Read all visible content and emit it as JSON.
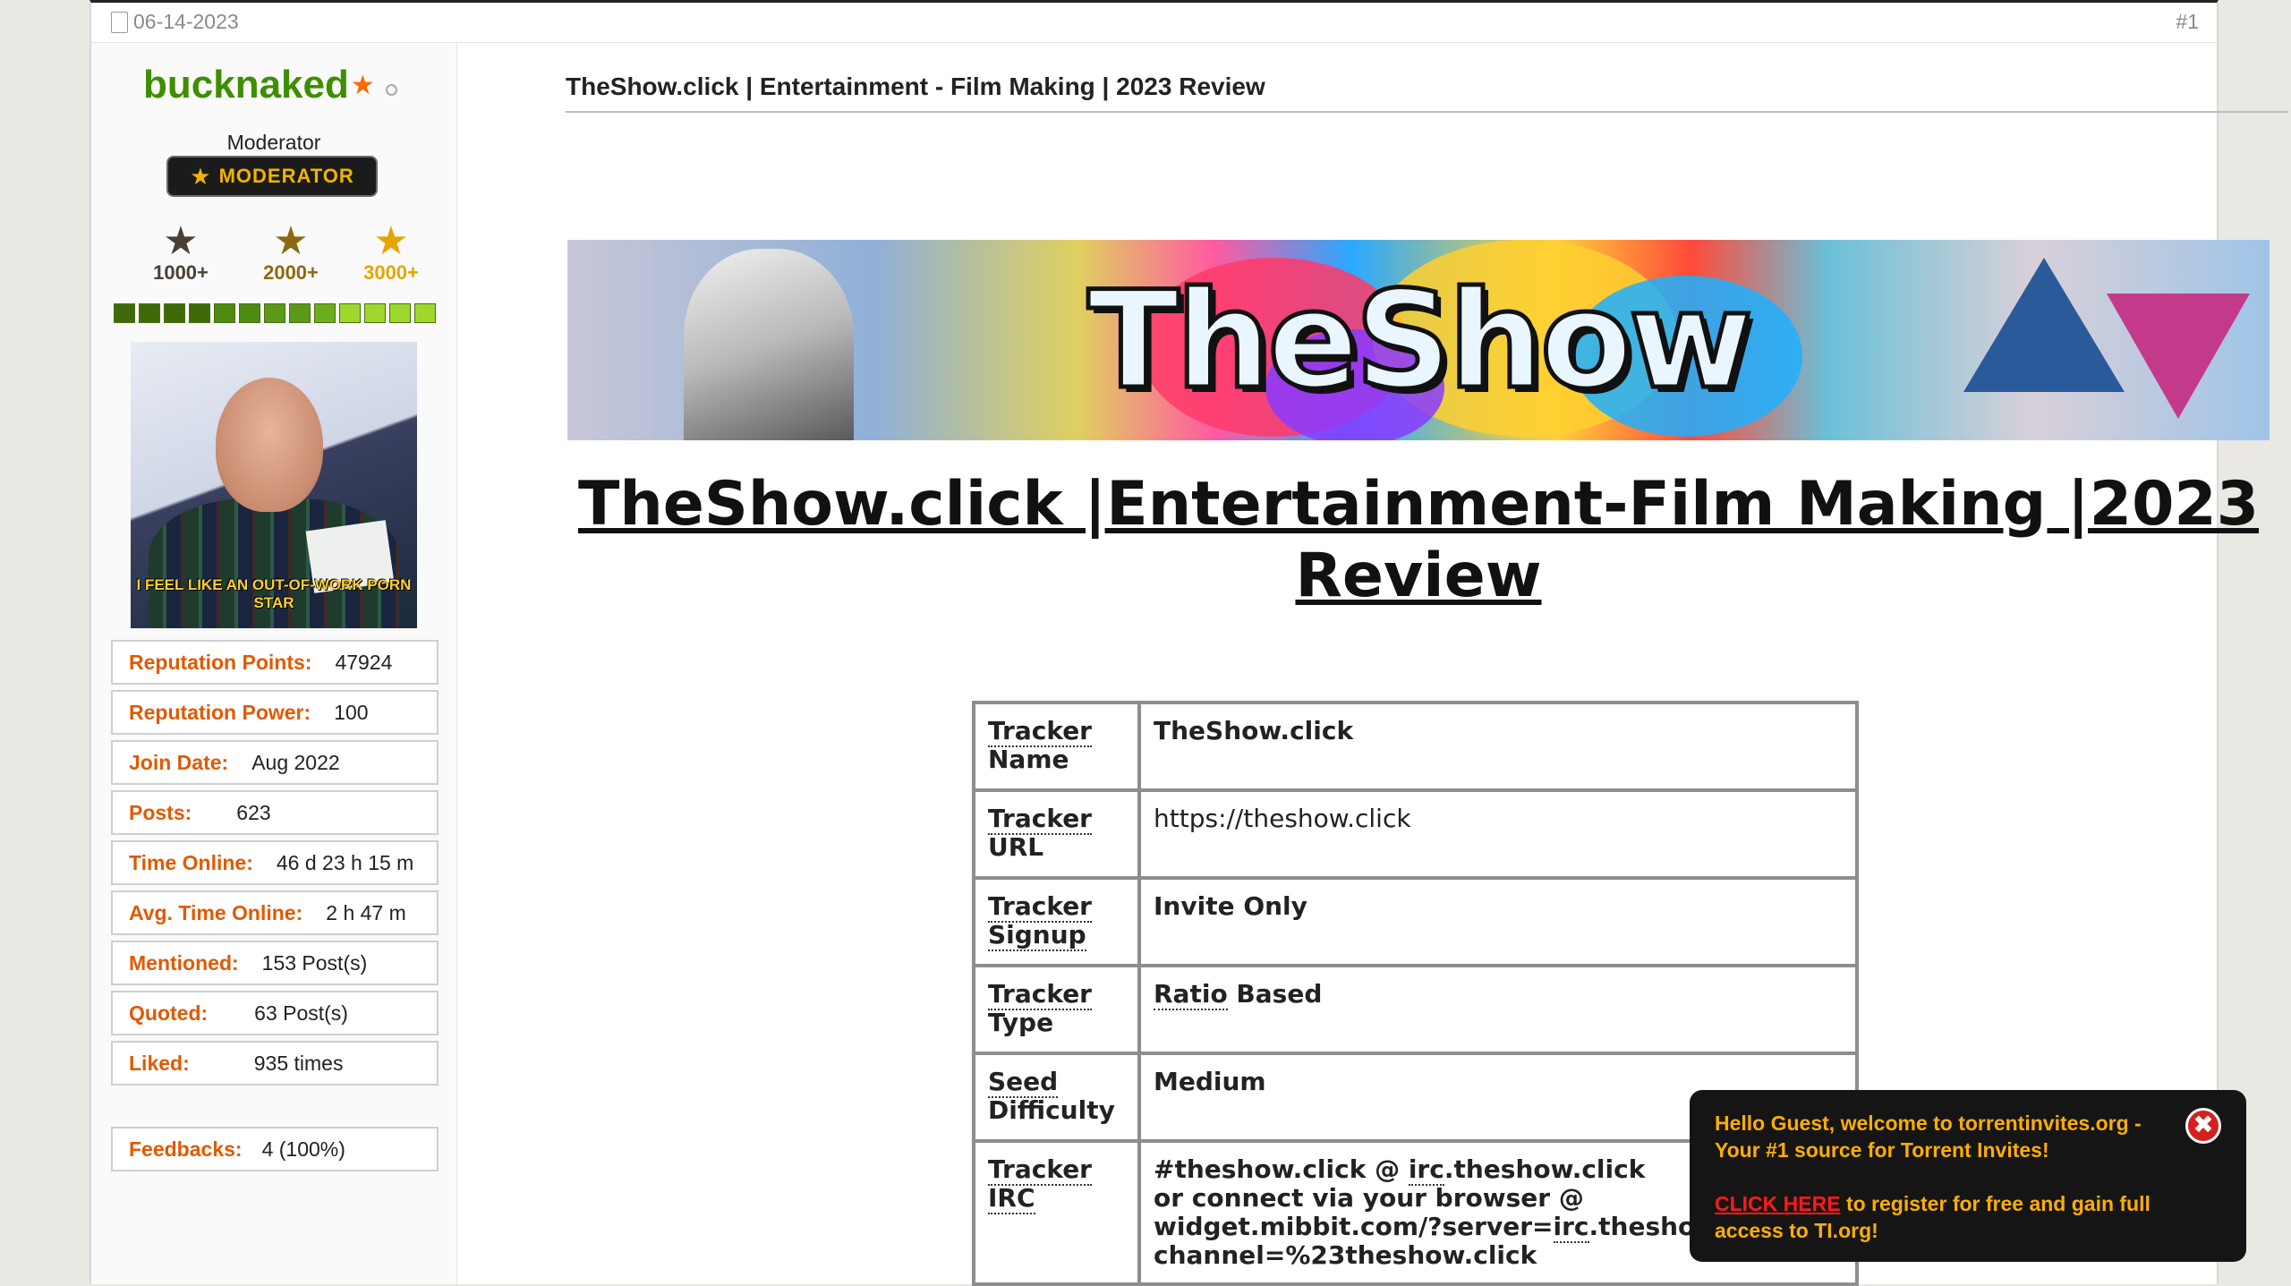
{
  "post": {
    "date": "06-14-2023",
    "number": "#1",
    "title": "TheShow.click | Entertainment - Film Making | 2023 Review"
  },
  "user": {
    "name": "bucknaked",
    "title": "Moderator",
    "badge": "MODERATOR",
    "ranks": [
      "1000+",
      "2000+",
      "3000+"
    ],
    "reputation_segments": 13,
    "reputation_colors": [
      "#3e6b0a",
      "#3e6b0a",
      "#3e6b0a",
      "#3e6b0a",
      "#4c8a12",
      "#4c8a12",
      "#5a9a18",
      "#5a9a18",
      "#6aae1f",
      "#9ed82c",
      "#9ed82c",
      "#9ed82c",
      "#9ed82c"
    ],
    "avatar_caption": "I FEEL LIKE AN OUT-OF-WORK PORN STAR",
    "stats": [
      {
        "label": "Reputation Points:",
        "value": "47924"
      },
      {
        "label": "Reputation Power:",
        "value": "100"
      },
      {
        "label": "Join Date:",
        "value": "Aug 2022"
      },
      {
        "label": "Posts:",
        "value": "623"
      },
      {
        "label": "Time Online:",
        "value": "46 d 23 h 15 m"
      },
      {
        "label": "Avg. Time Online:",
        "value": "2 h 47 m"
      },
      {
        "label": "Mentioned:",
        "value": "153 Post(s)"
      },
      {
        "label": "Quoted:",
        "value": "63 Post(s)"
      },
      {
        "label": "Liked:",
        "value": "935 times"
      }
    ],
    "feedbacks": {
      "label": "Feedbacks:",
      "value": "4 (100%)"
    }
  },
  "banner": {
    "text": "TheShow"
  },
  "heading": "TheShow.click |Entertainment-Film Making |2023 Review",
  "tracker": {
    "rows": [
      {
        "label_a": "Tracker",
        "label_b": "Name",
        "value": "TheShow.click"
      },
      {
        "label_a": "Tracker",
        "label_b": "URL",
        "value": "https://theshow.click"
      },
      {
        "label_a": "Tracker",
        "label_b": "Signup",
        "value": "Invite Only"
      },
      {
        "label_a": "Tracker",
        "label_b": "Type",
        "value_a": "Ratio",
        "value_b": " Based"
      },
      {
        "label_a": "Seed",
        "label_b": "Difficulty",
        "value": "Medium"
      },
      {
        "label_a": "Tracker",
        "label_b": "IRC",
        "line1_a": "#theshow.click @ ",
        "line1_b": "irc",
        "line1_c": ".theshow.click",
        "line2": "or connect via your browser @",
        "line3_a": "widget.mibbit.com/?server=",
        "line3_b": "irc",
        "line3_c": ".theshow.click&",
        "line4": "channel=%23theshow.click"
      }
    ]
  },
  "guest": {
    "welcome": "Hello Guest, welcome to torrentinvites.org - Your #1 source for Torrent Invites!",
    "cta": "CLICK HERE",
    "cta_rest": " to register for free and gain full access to TI.org!",
    "close": "✖"
  },
  "colors": {
    "username": "#3e8e00",
    "stat_label": "#e05a00",
    "cta": "#ff1a1a",
    "guest_text": "#ffae00"
  }
}
